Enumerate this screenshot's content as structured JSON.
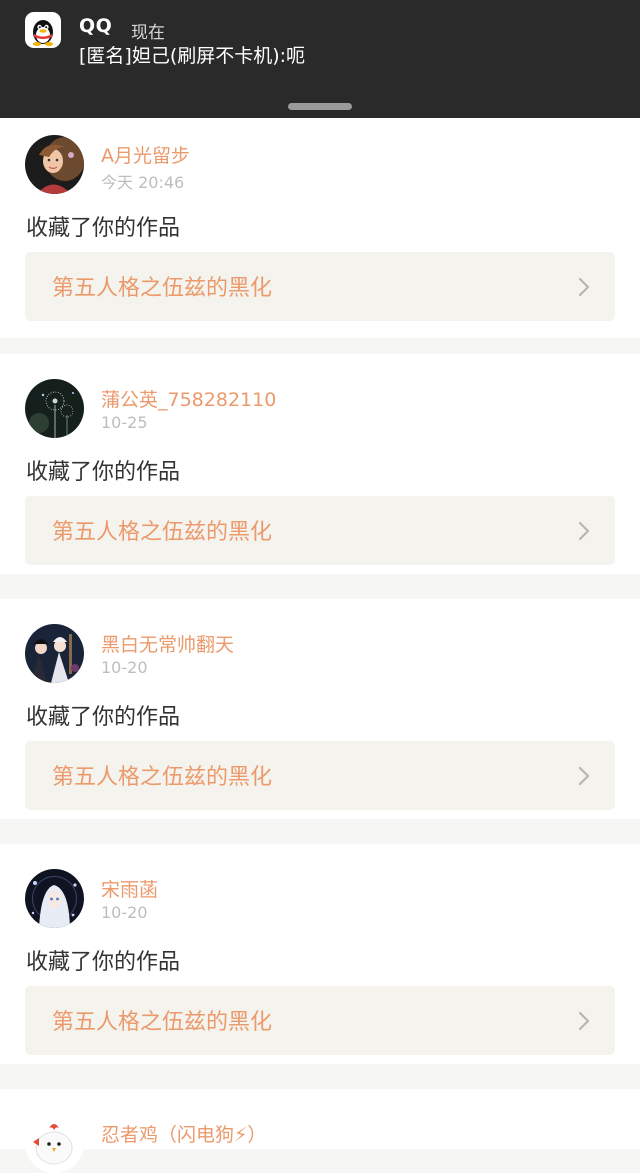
{
  "notification": {
    "app_name": "QQ",
    "time": "现在",
    "message": "[匿名]妲己(刷屏不卡机):呃",
    "app_icon": "qq-penguin-icon"
  },
  "feed": [
    {
      "username": "A月光留步",
      "date": "今天 20:46",
      "action": "收藏了你的作品",
      "work_title": "第五人格之伍兹的黑化",
      "avatar": "girl-portrait"
    },
    {
      "username": "蒲公英_758282110",
      "date": "10-25",
      "action": "收藏了你的作品",
      "work_title": "第五人格之伍兹的黑化",
      "avatar": "dandelion"
    },
    {
      "username": "黑白无常帅翻天",
      "date": "10-20",
      "action": "收藏了你的作品",
      "work_title": "第五人格之伍兹的黑化",
      "avatar": "anime-duo"
    },
    {
      "username": "宋雨菡",
      "date": "10-20",
      "action": "收藏了你的作品",
      "work_title": "第五人格之伍兹的黑化",
      "avatar": "anime-white-hair"
    },
    {
      "username": "忍者鸡（闪电狗⚡）",
      "avatar": "chicken"
    }
  ],
  "colors": {
    "accent": "#ec9a6c",
    "banner_bg": "#2a2a2a",
    "card_bg": "#ffffff",
    "work_bg": "#f4f3ee",
    "page_bg": "#f6f6f4"
  }
}
